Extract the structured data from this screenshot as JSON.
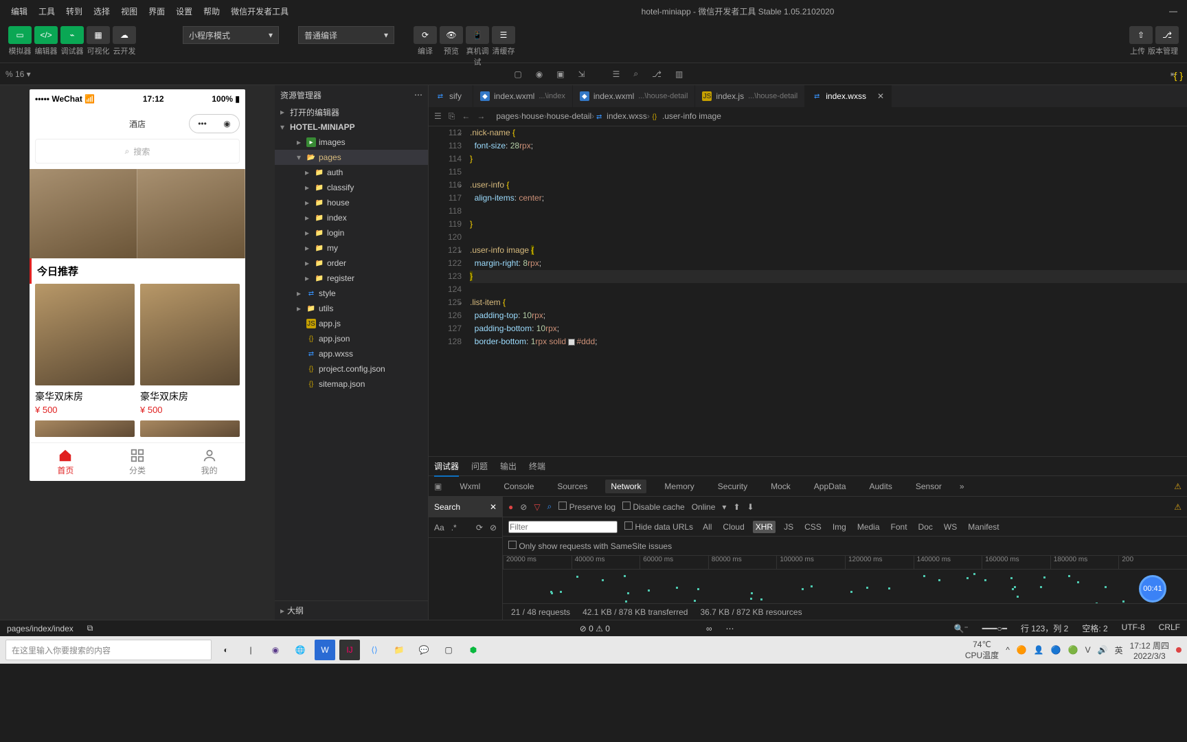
{
  "menubar": {
    "items": [
      "编辑",
      "工具",
      "转到",
      "选择",
      "视图",
      "界面",
      "设置",
      "帮助",
      "微信开发者工具"
    ],
    "title": "hotel-miniapp - 微信开发者工具 Stable 1.05.2102020"
  },
  "toolbar": {
    "buttons": [
      "模拟器",
      "编辑器",
      "调试器",
      "可视化",
      "云开发"
    ],
    "mode": "小程序模式",
    "compile": "普通编译",
    "actions": [
      "编译",
      "预览",
      "真机调试",
      "清缓存"
    ],
    "upload": "上传",
    "version": "版本管理"
  },
  "secondbar": {
    "zoom": "% 16 ▾"
  },
  "phone": {
    "carrier": "WeChat",
    "time": "17:12",
    "battery": "100%",
    "title": "酒店",
    "search": "搜索",
    "section": "今日推荐",
    "room": "豪华双床房",
    "price": "¥ 500",
    "tabs": [
      "首页",
      "分类",
      "我的"
    ]
  },
  "explorer": {
    "title": "资源管理器",
    "sections": [
      "打开的编辑器",
      "HOTEL-MINIAPP"
    ],
    "outline": "大纲",
    "tree": [
      {
        "l": "images",
        "d": 2,
        "i": "fimg",
        "a": "▸"
      },
      {
        "l": "pages",
        "d": 2,
        "i": "fopen",
        "a": "▾",
        "sel": true
      },
      {
        "l": "auth",
        "d": 3,
        "i": "folder",
        "a": "▸"
      },
      {
        "l": "classify",
        "d": 3,
        "i": "folder",
        "a": "▸"
      },
      {
        "l": "house",
        "d": 3,
        "i": "folder",
        "a": "▸"
      },
      {
        "l": "index",
        "d": 3,
        "i": "folder",
        "a": "▸"
      },
      {
        "l": "login",
        "d": 3,
        "i": "folder",
        "a": "▸"
      },
      {
        "l": "my",
        "d": 3,
        "i": "folder",
        "a": "▸"
      },
      {
        "l": "order",
        "d": 3,
        "i": "folder",
        "a": "▸"
      },
      {
        "l": "register",
        "d": 3,
        "i": "folder",
        "a": "▸"
      },
      {
        "l": "style",
        "d": 2,
        "i": "fwxss",
        "a": "▸"
      },
      {
        "l": "utils",
        "d": 2,
        "i": "folder",
        "a": "▸"
      },
      {
        "l": "app.js",
        "d": 2,
        "i": "fjs",
        "a": ""
      },
      {
        "l": "app.json",
        "d": 2,
        "i": "fjson",
        "a": ""
      },
      {
        "l": "app.wxss",
        "d": 2,
        "i": "fwxss",
        "a": ""
      },
      {
        "l": "project.config.json",
        "d": 2,
        "i": "fjson",
        "a": ""
      },
      {
        "l": "sitemap.json",
        "d": 2,
        "i": "fjson",
        "a": ""
      }
    ]
  },
  "tabs": [
    {
      "n": "sify",
      "p": "",
      "i": "fwxss"
    },
    {
      "n": "index.wxml",
      "p": "...\\index",
      "i": "fwxml"
    },
    {
      "n": "index.wxml",
      "p": "...\\house-detail",
      "i": "fwxml"
    },
    {
      "n": "index.js",
      "p": "...\\house-detail",
      "i": "fjs"
    },
    {
      "n": "index.wxss",
      "p": "",
      "i": "fwxss",
      "active": true
    }
  ],
  "breadcrumb": [
    "pages",
    "house",
    "house-detail",
    "index.wxss",
    ".user-info image"
  ],
  "code": {
    "start": 112,
    "lines": [
      [
        {
          "t": ".nick-name ",
          "c": "sel"
        },
        {
          "t": "{",
          "c": "br"
        }
      ],
      [
        {
          "t": "  "
        },
        {
          "t": "font-size",
          "c": "prop"
        },
        {
          "t": ": ",
          "c": "pun"
        },
        {
          "t": "28",
          "c": "num"
        },
        {
          "t": "rpx",
          "c": "val"
        },
        {
          "t": ";",
          "c": "pun"
        }
      ],
      [
        {
          "t": "}",
          "c": "br"
        }
      ],
      [],
      [
        {
          "t": ".user-info ",
          "c": "sel"
        },
        {
          "t": "{",
          "c": "br"
        }
      ],
      [
        {
          "t": "  "
        },
        {
          "t": "align-items",
          "c": "prop"
        },
        {
          "t": ": ",
          "c": "pun"
        },
        {
          "t": "center",
          "c": "val"
        },
        {
          "t": ";",
          "c": "pun"
        }
      ],
      [],
      [
        {
          "t": "}",
          "c": "br"
        }
      ],
      [],
      [
        {
          "t": ".user-info ",
          "c": "sel"
        },
        {
          "t": "image ",
          "c": "sel"
        },
        {
          "t": "{",
          "c": "br",
          "hl": true
        }
      ],
      [
        {
          "t": "  "
        },
        {
          "t": "margin-right",
          "c": "prop"
        },
        {
          "t": ": ",
          "c": "pun"
        },
        {
          "t": "8",
          "c": "num"
        },
        {
          "t": "rpx",
          "c": "val"
        },
        {
          "t": ";",
          "c": "pun"
        }
      ],
      [
        {
          "t": "}",
          "c": "br",
          "hl": true,
          "rowhl": true
        }
      ],
      [],
      [
        {
          "t": ".list-item ",
          "c": "sel"
        },
        {
          "t": "{",
          "c": "br"
        }
      ],
      [
        {
          "t": "  "
        },
        {
          "t": "padding-top",
          "c": "prop"
        },
        {
          "t": ": ",
          "c": "pun"
        },
        {
          "t": "10",
          "c": "num"
        },
        {
          "t": "rpx",
          "c": "val"
        },
        {
          "t": ";",
          "c": "pun"
        }
      ],
      [
        {
          "t": "  "
        },
        {
          "t": "padding-bottom",
          "c": "prop"
        },
        {
          "t": ": ",
          "c": "pun"
        },
        {
          "t": "10",
          "c": "num"
        },
        {
          "t": "rpx",
          "c": "val"
        },
        {
          "t": ";",
          "c": "pun"
        }
      ],
      [
        {
          "t": "  "
        },
        {
          "t": "border-bottom",
          "c": "prop"
        },
        {
          "t": ": ",
          "c": "pun"
        },
        {
          "t": "1",
          "c": "num"
        },
        {
          "t": "rpx ",
          "c": "val"
        },
        {
          "t": "solid ",
          "c": "val"
        },
        {
          "t": "SW",
          "c": "sw"
        },
        {
          "t": "#ddd",
          "c": "val"
        },
        {
          "t": ";",
          "c": "pun"
        }
      ]
    ],
    "folds": [
      112,
      116,
      121,
      125
    ]
  },
  "devtools": {
    "tabs": [
      "调试器",
      "问题",
      "输出",
      "终端"
    ],
    "panels": [
      "Wxml",
      "Console",
      "Sources",
      "Network",
      "Memory",
      "Security",
      "Mock",
      "AppData",
      "Audits",
      "Sensor"
    ],
    "search": "Search",
    "preserve": "Preserve log",
    "disable": "Disable cache",
    "online": "Online",
    "filter_placeholder": "Filter",
    "hideurls": "Hide data URLs",
    "filters": [
      "All",
      "Cloud",
      "XHR",
      "JS",
      "CSS",
      "Img",
      "Media",
      "Font",
      "Doc",
      "WS",
      "Manifest"
    ],
    "samesite": "Only show requests with SameSite issues",
    "ticks": [
      "20000 ms",
      "40000 ms",
      "60000 ms",
      "80000 ms",
      "100000 ms",
      "120000 ms",
      "140000 ms",
      "160000 ms",
      "180000 ms",
      "200"
    ],
    "timer": "00:41",
    "status": [
      "21 / 48 requests",
      "42.1 KB / 878 KB transferred",
      "36.7 KB / 872 KB resources"
    ]
  },
  "statusbar": {
    "left": [
      "pages/index/index"
    ],
    "mid": [
      "⊘ 0",
      "⚠ 0"
    ],
    "right": [
      "行 123，列 2",
      "空格: 2",
      "UTF-8",
      "CRLF"
    ]
  },
  "taskbar": {
    "search": "在这里输入你要搜索的内容",
    "temp": "74℃",
    "cpu": "CPU温度",
    "ime": "英",
    "time": "17:12 周四",
    "date": "2022/3/3"
  }
}
